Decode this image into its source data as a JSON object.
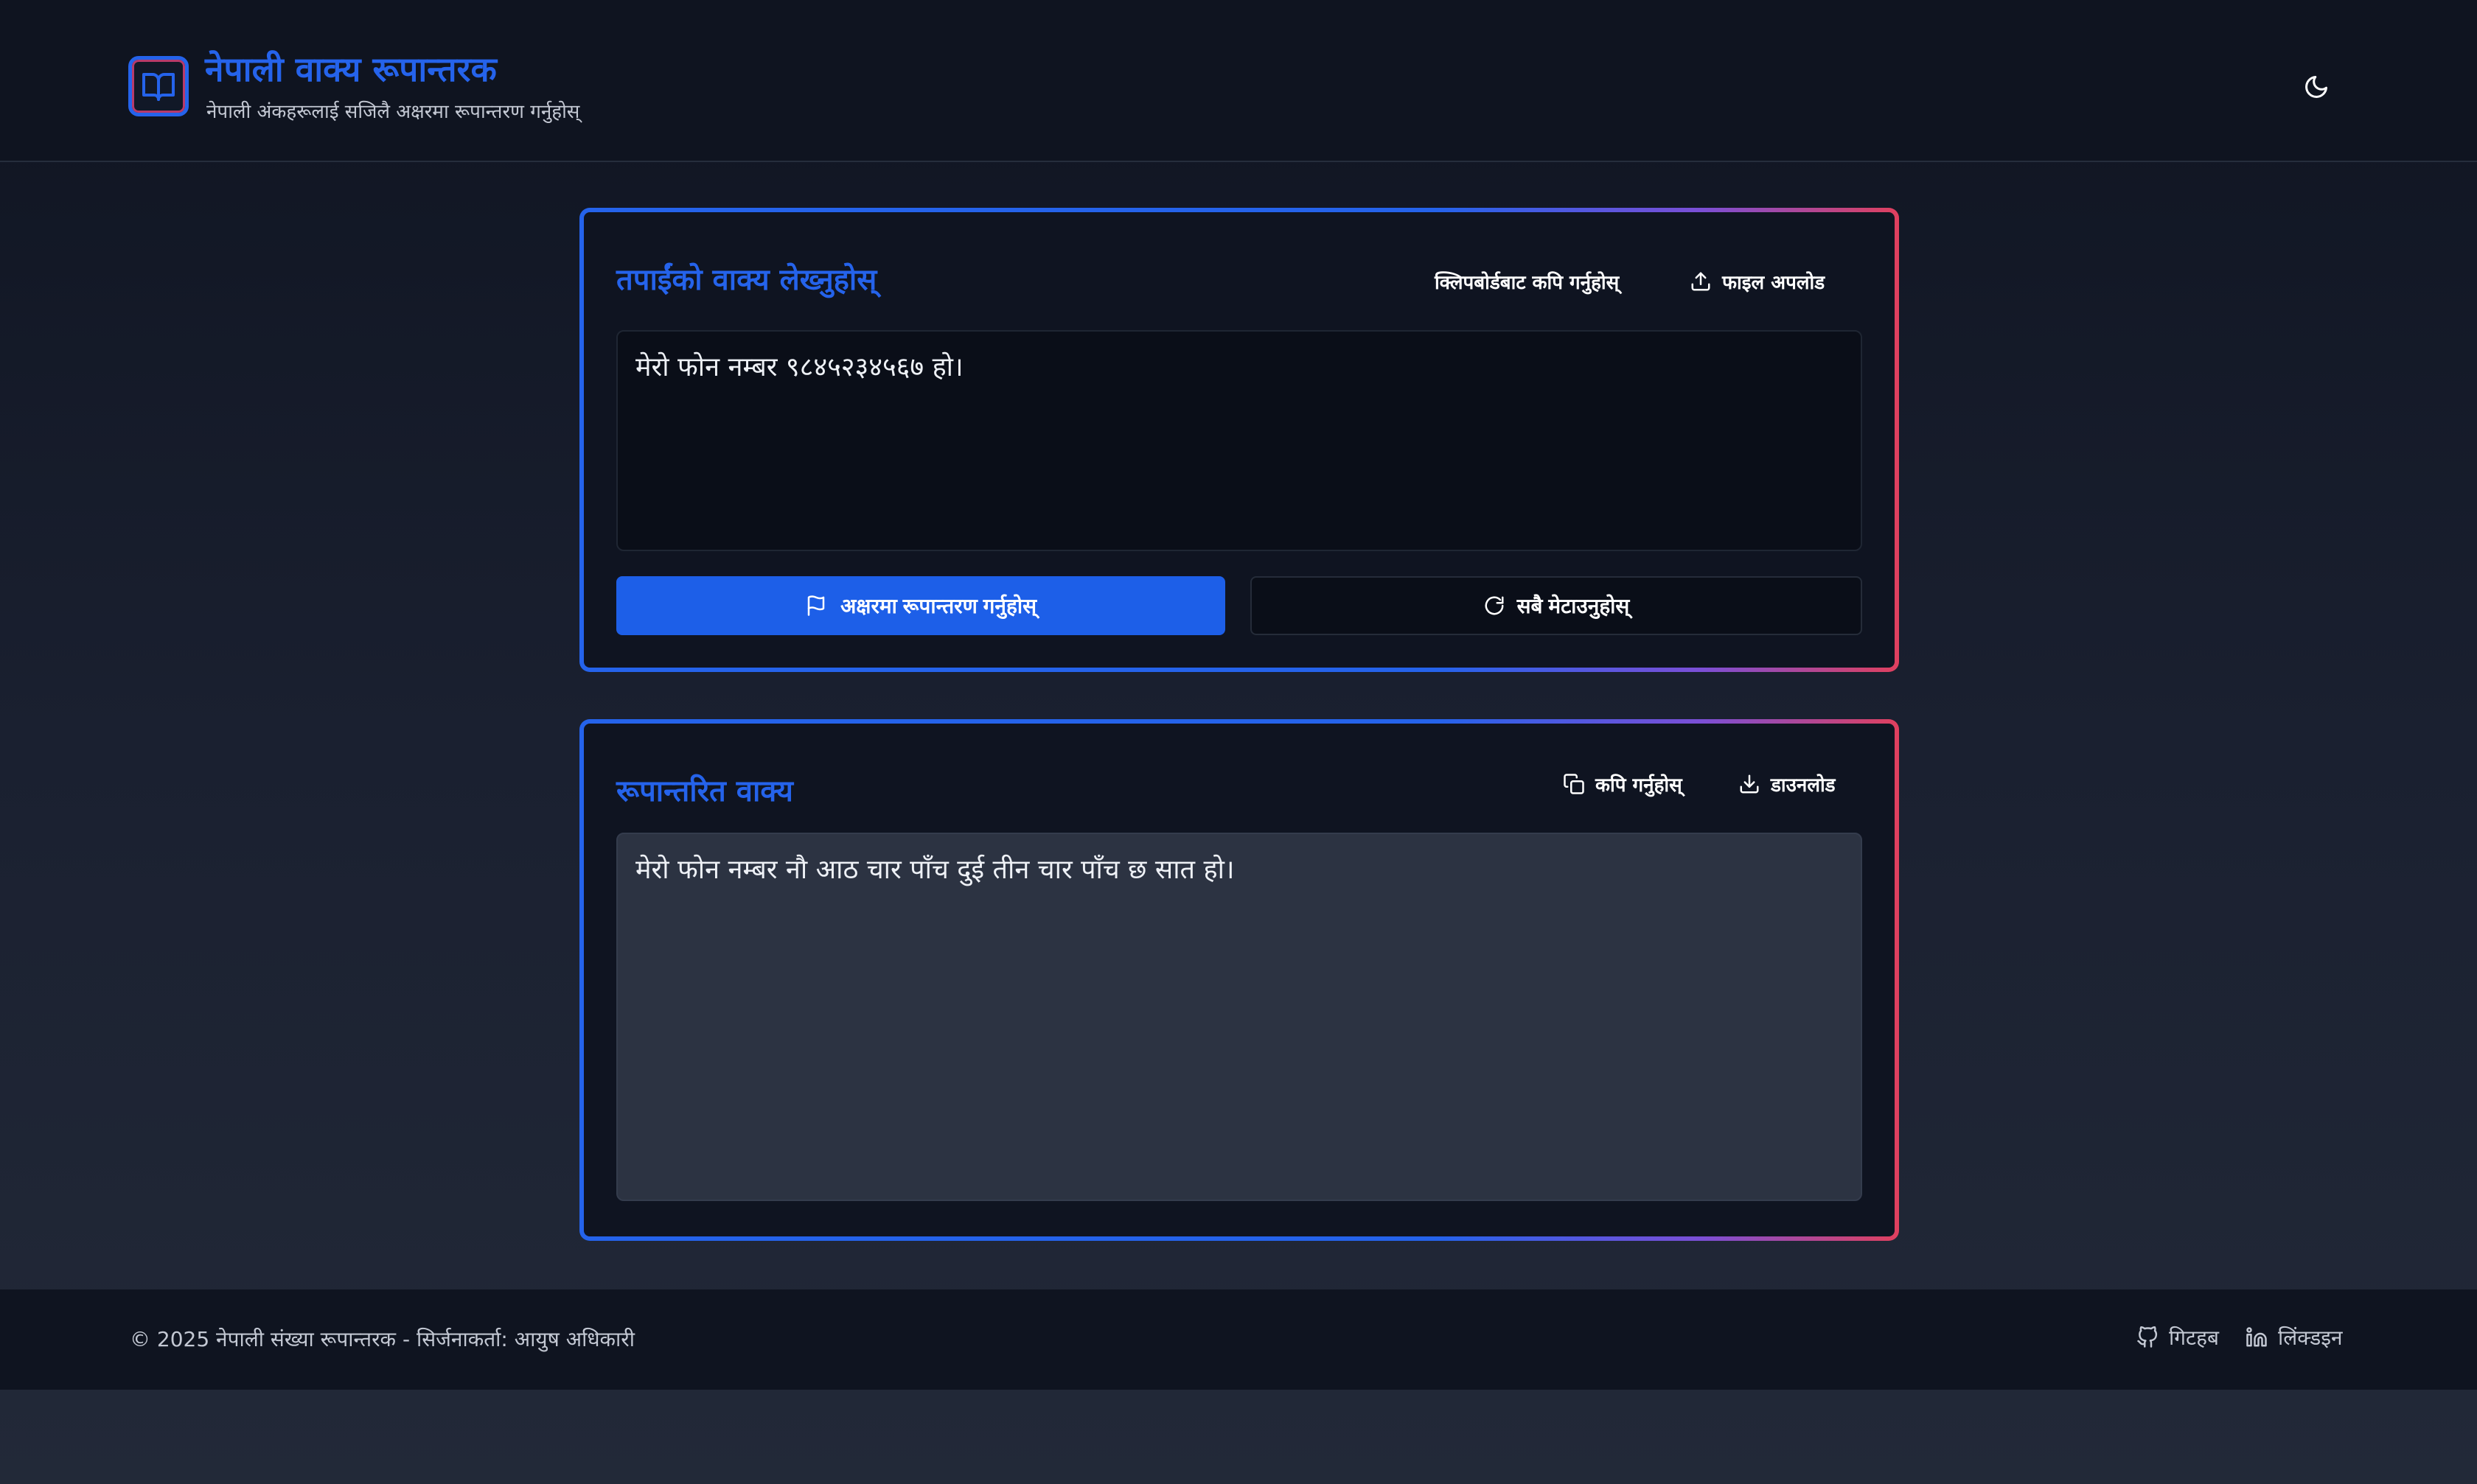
{
  "header": {
    "title": "नेपाली वाक्य रूपान्तरक",
    "subtitle": "नेपाली अंकहरूलाई सजिलै अक्षरमा रूपान्तरण गर्नुहोस्",
    "logo_icon": "book-open-icon",
    "theme_toggle_icon": "moon-icon"
  },
  "input_card": {
    "title": "तपाईंको वाक्य लेख्नुहोस्",
    "clipboard_label": "क्लिपबोर्डबाट कपि गर्नुहोस्",
    "upload_label": "फाइल अपलोड",
    "upload_icon": "upload-icon",
    "text_value": "मेरो फोन नम्बर ९८४५२३४५६७ हो।",
    "convert_label": "अक्षरमा रूपान्तरण गर्नुहोस्",
    "convert_icon": "flag-icon",
    "clear_label": "सबै मेटाउनुहोस्",
    "clear_icon": "refresh-icon"
  },
  "output_card": {
    "title": "रूपान्तरित वाक्य",
    "copy_label": "कपि गर्नुहोस्",
    "copy_icon": "copy-icon",
    "download_label": "डाउनलोड",
    "download_icon": "download-icon",
    "text_value": "मेरो फोन नम्बर नौ आठ चार पाँच दुई तीन चार पाँच छ सात हो।"
  },
  "footer": {
    "copyright": "© 2025 नेपाली संख्या रूपान्तरक - सिर्जनाकर्ता: आयुष अधिकारी",
    "github_label": "गिटहब",
    "linkedin_label": "लिंक्डइन"
  },
  "colors": {
    "accent": "#2563eb",
    "gradient_end": "#e0405e",
    "background": "#0f1421"
  }
}
